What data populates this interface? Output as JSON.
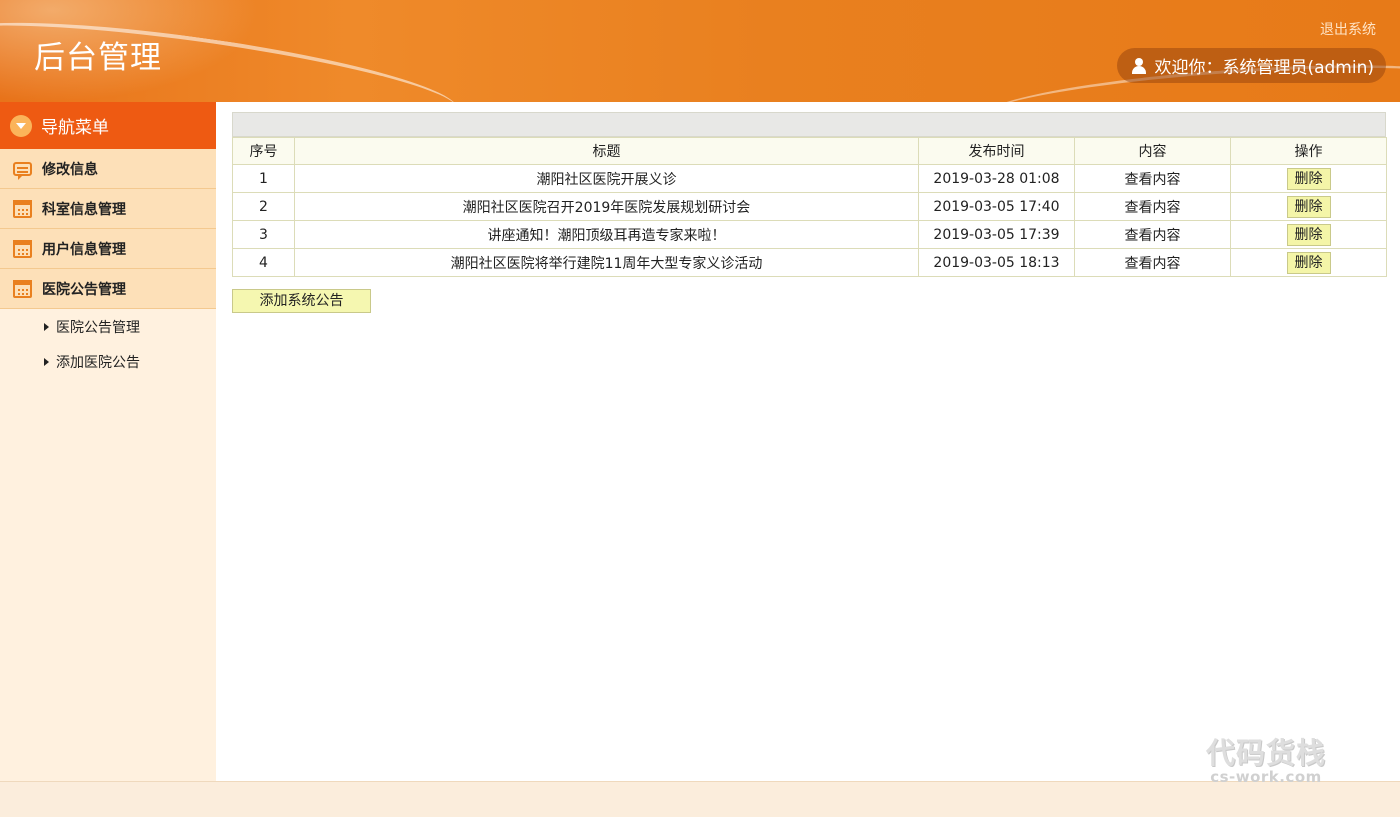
{
  "header": {
    "title": "后台管理",
    "logout_label": "退出系统",
    "welcome_text": "欢迎你：系统管理员(admin)"
  },
  "sidebar": {
    "heading": "导航菜单",
    "items": [
      {
        "label": "修改信息",
        "icon": "message-icon"
      },
      {
        "label": "科室信息管理",
        "icon": "calendar-icon"
      },
      {
        "label": "用户信息管理",
        "icon": "calendar-icon"
      },
      {
        "label": "医院公告管理",
        "icon": "calendar-icon"
      }
    ],
    "sub_items": [
      {
        "label": "医院公告管理"
      },
      {
        "label": "添加医院公告"
      }
    ]
  },
  "table": {
    "headers": [
      "序号",
      "标题",
      "发布时间",
      "内容",
      "操作"
    ],
    "rows": [
      {
        "index": "1",
        "title": "潮阳社区医院开展义诊",
        "time": "2019-03-28 01:08",
        "content": "查看内容",
        "action": "删除"
      },
      {
        "index": "2",
        "title": "潮阳社区医院召开2019年医院发展规划研讨会",
        "time": "2019-03-05 17:40",
        "content": "查看内容",
        "action": "删除"
      },
      {
        "index": "3",
        "title": "讲座通知！潮阳顶级耳再造专家来啦！",
        "time": "2019-03-05 17:39",
        "content": "查看内容",
        "action": "删除"
      },
      {
        "index": "4",
        "title": "潮阳社区医院将举行建院11周年大型专家义诊活动",
        "time": "2019-03-05 18:13",
        "content": "查看内容",
        "action": "删除"
      }
    ]
  },
  "add_button_label": "添加系统公告",
  "watermark": {
    "line1": "代码货栈",
    "line2": "cs-work.com"
  },
  "colors": {
    "header": "#e9801f",
    "nav_head": "#ee5a12",
    "nav_item": "#fde0b8",
    "sidebar_bg": "#fff1df",
    "button_bg": "#f4f5a8"
  }
}
